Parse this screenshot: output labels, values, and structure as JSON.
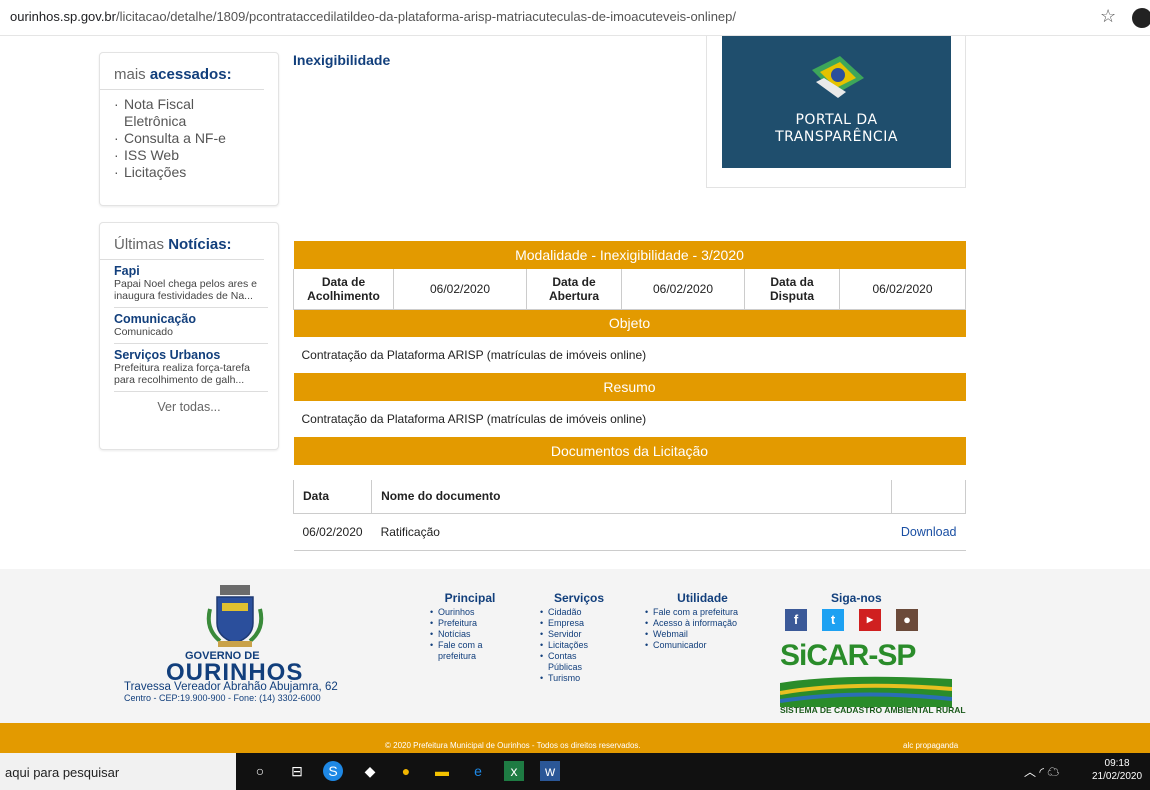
{
  "browser": {
    "url_host": "ourinhos.sp.gov.br",
    "url_path": "/licitacao/detalhe/1809/pcontrataccedilatildeo-da-plataforma-arisp-matriacuteculas-de-imoacuteveis-onlinep/"
  },
  "sidebar": {
    "accessed_prefix": "mais",
    "accessed_bold": "acessados:",
    "links": [
      "Nota Fiscal",
      "Eletrônica",
      "Consulta a NF-e",
      "ISS Web",
      "Licitações"
    ],
    "news_prefix": "Últimas",
    "news_bold": "Notícias:",
    "news": [
      {
        "title": "Fapi",
        "line1": "Papai Noel chega pelos ares e",
        "line2": "inaugura festividades de Na..."
      },
      {
        "title": "Comunicação",
        "line1": "Comunicado",
        "line2": ""
      },
      {
        "title": "Serviços Urbanos",
        "line1": "Prefeitura realiza força-tarefa",
        "line2": "para recolhimento de galh..."
      }
    ],
    "ver_todas": "Ver todas..."
  },
  "main": {
    "heading": "Inexigibilidade",
    "portal_line1": "PORTAL DA",
    "portal_line2": "TRANSPARÊNCIA",
    "modalidade": "Modalidade - Inexigibilidade - 3/2020",
    "dates": {
      "acolhimento_l1": "Data de",
      "acolhimento_l2": "Acolhimento",
      "acolhimento_v": "06/02/2020",
      "abertura_l1": "Data de",
      "abertura_l2": "Abertura",
      "abertura_v": "06/02/2020",
      "disputa_l1": "Data da",
      "disputa_l2": "Disputa",
      "disputa_v": "06/02/2020"
    },
    "objeto_label": "Objeto",
    "objeto_text": "Contratação da Plataforma ARISP (matrículas de imóveis online)",
    "resumo_label": "Resumo",
    "resumo_text": "Contratação da Plataforma ARISP (matrículas de imóveis online)",
    "docs_label": "Documentos da Licitação",
    "docs_header": {
      "data": "Data",
      "nome": "Nome do documento"
    },
    "docs_row": {
      "data": "06/02/2020",
      "nome": "Ratificação",
      "action": "Download"
    }
  },
  "footer": {
    "gov": "GOVERNO DE",
    "city": "OURINHOS",
    "address": "Travessa Vereador Abrahão Abujamra, 62",
    "cep": "Centro - CEP:19.900-900 - Fone: (14) 3302-6000",
    "principal_title": "Principal",
    "principal": [
      "Ourinhos",
      "Prefeitura",
      "Notícias",
      "Fale com a",
      "prefeitura"
    ],
    "servicos_title": "Serviços",
    "servicos": [
      "Cidadão",
      "Empresa",
      "Servidor",
      "Licitações",
      "Contas",
      "Públicas",
      "Turismo"
    ],
    "utilidade_title": "Utilidade",
    "utilidade": [
      "Fale com a prefeitura",
      "Acesso à informação",
      "Webmail",
      "Comunicador"
    ],
    "siga": "Siga-nos",
    "sicar": "SiCAR-SP",
    "sicar_sub": "SISTEMA DE CADASTRO AMBIENTAL RURAL",
    "copyright": "© 2020 Prefeitura Municipal de Ourinhos - Todos os direitos reservados.",
    "agency": "alc propaganda"
  },
  "taskbar": {
    "search": "aqui para pesquisar",
    "time": "09:18",
    "date": "21/02/2020"
  },
  "colors": {
    "accent": "#e39a00",
    "navy": "#123f7c",
    "portal": "#1f4e6d"
  }
}
